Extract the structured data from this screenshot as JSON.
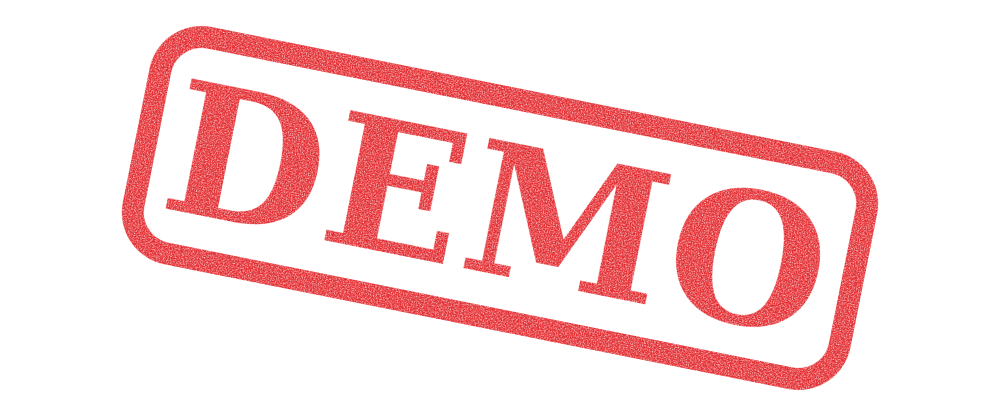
{
  "stamp": {
    "text": "DEMO",
    "color": "#e3262b",
    "background": "#ffffff",
    "style": "rubber-stamp-grunge"
  }
}
